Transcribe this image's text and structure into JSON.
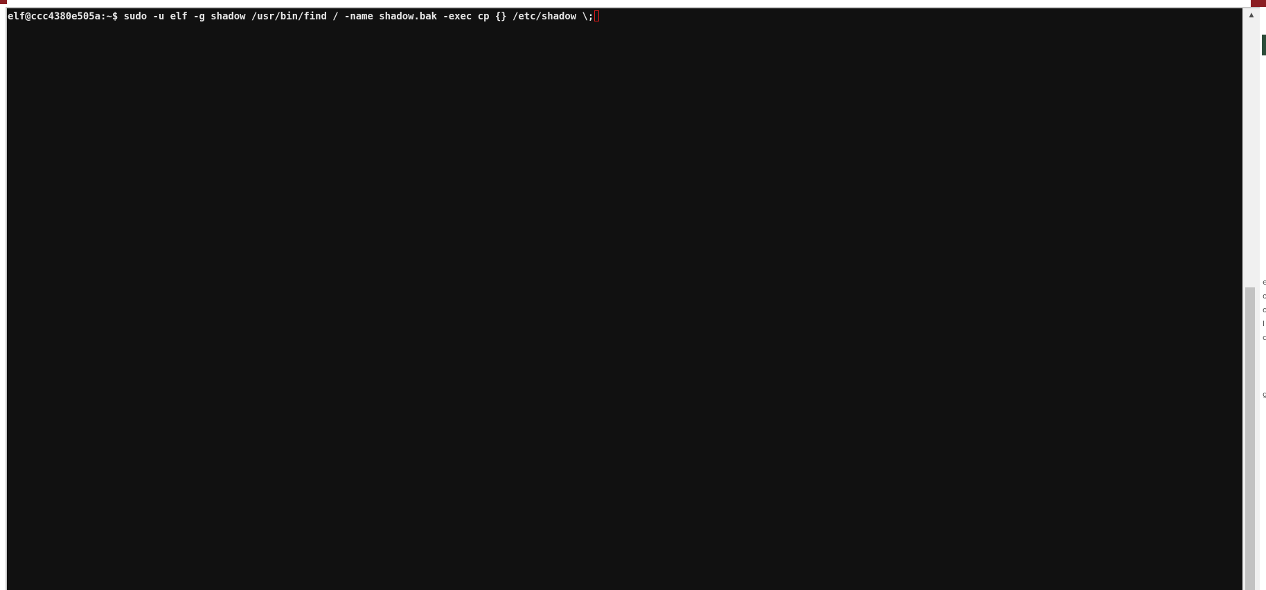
{
  "terminal": {
    "prompt": "elf@ccc4380e505a:~$",
    "command": " sudo -u elf -g shadow /usr/bin/find / -name shadow.bak -exec cp {} /etc/shadow \\;"
  },
  "scrollbar": {
    "up_arrow": "▲",
    "thumb_position": 0.48
  },
  "background_page": {
    "fragments": [
      "e",
      "o",
      "o",
      "l",
      "c",
      "g"
    ]
  },
  "colors": {
    "terminal_bg": "#111111",
    "terminal_fg": "#e6e6e6",
    "cursor": "#d11a1a",
    "accent": "#8b1e23"
  }
}
